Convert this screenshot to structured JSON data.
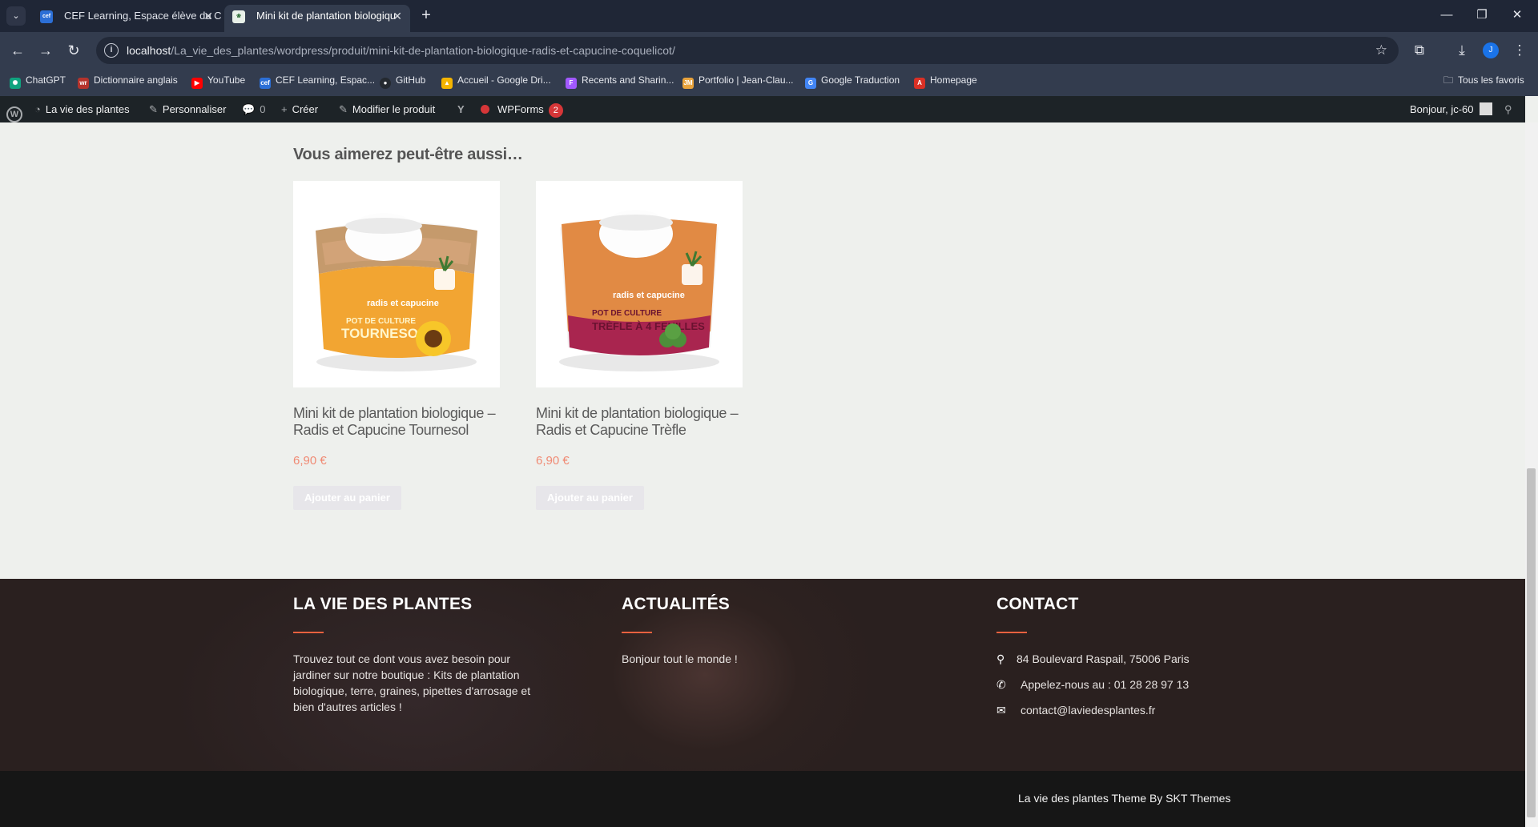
{
  "browser": {
    "tabs": [
      {
        "label": "CEF Learning, Espace élève du C",
        "favicon": "cef-icon"
      },
      {
        "label": "Mini kit de plantation biologiqu",
        "favicon": "site-icon",
        "active": true
      }
    ],
    "url_host": "localhost",
    "url_path": "/La_vie_des_plantes/wordpress/produit/mini-kit-de-plantation-biologique-radis-et-capucine-coquelicot/",
    "profile_initial": "J",
    "bookmarks": [
      {
        "label": "ChatGPT",
        "color": "#10a37f"
      },
      {
        "label": "Dictionnaire anglais",
        "color": "#b5332c"
      },
      {
        "label": "YouTube",
        "color": "#ff0000"
      },
      {
        "label": "CEF Learning, Espac...",
        "color": "#2c6fd6"
      },
      {
        "label": "GitHub",
        "color": "#24292f"
      },
      {
        "label": "Accueil - Google Dri...",
        "color": "#f4b400"
      },
      {
        "label": "Recents and Sharin...",
        "color": "#a259ff"
      },
      {
        "label": "Portfolio | Jean-Clau...",
        "color": "#e8a33d"
      },
      {
        "label": "Google Traduction",
        "color": "#4285f4"
      },
      {
        "label": "Homepage",
        "color": "#d93025"
      }
    ],
    "all_bookmarks": "Tous les favoris"
  },
  "adminbar": {
    "site": "La vie des plantes",
    "customize": "Personnaliser",
    "comments": "0",
    "create": "Créer",
    "edit": "Modifier le produit",
    "wpforms": "WPForms",
    "wpforms_count": "2",
    "greeting": "Bonjour, jc-60"
  },
  "related": {
    "title": "Vous aimerez peut-être aussi…",
    "products": [
      {
        "name": "Mini kit de plantation biologique – Radis et Capucine Tournesol",
        "price": "6,90 €",
        "button": "Ajouter au panier",
        "pack_text": "POT DE CULTURE",
        "pack_variety": "TOURNESOL",
        "brand": "radis et capucine"
      },
      {
        "name": "Mini kit de plantation biologique – Radis et Capucine Trèfle",
        "price": "6,90 €",
        "button": "Ajouter au panier",
        "pack_text": "POT DE CULTURE",
        "pack_variety": "TRÈFLE À 4 FEUILLES",
        "brand": "radis et capucine"
      }
    ]
  },
  "footer": {
    "col1": {
      "title": "LA VIE DES PLANTES",
      "text": "Trouvez tout ce dont vous avez besoin pour jardiner sur notre boutique : Kits de plantation biologique, terre, graines, pipettes d'arrosage et bien d'autres articles !"
    },
    "col2": {
      "title": "ACTUALITÉS",
      "link": "Bonjour tout le monde !"
    },
    "col3": {
      "title": "CONTACT",
      "address": "84 Boulevard Raspail, 75006 Paris",
      "phone": "Appelez-nous au : 01 28 28 97 13",
      "email": "contact@laviedesplantes.fr"
    },
    "credit": "La vie des plantes Theme By SKT Themes",
    "accent_color": "#e8613f"
  }
}
